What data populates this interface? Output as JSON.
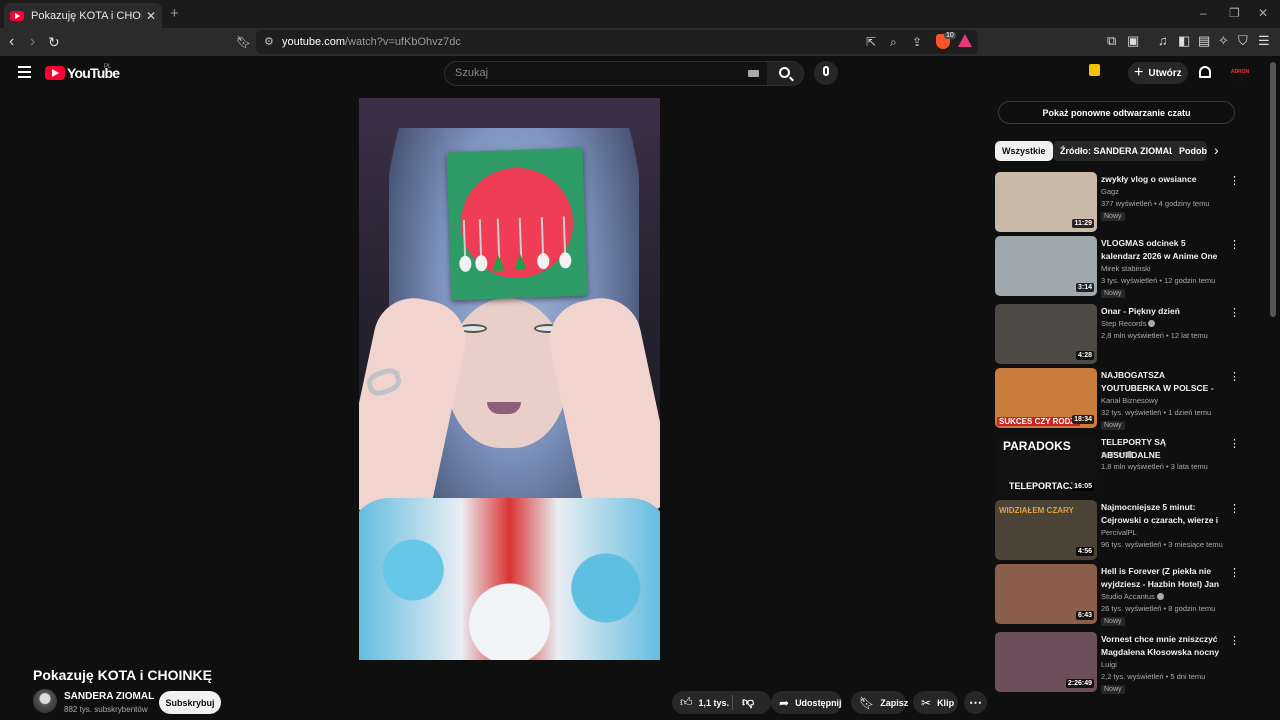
{
  "browser": {
    "tab_title": "Pokazuję KOTA i CHOINKĘ - YouTube",
    "url_host": "youtube.com",
    "url_path": "/watch?v=ufKbOhvz7dc",
    "brave_count": "10"
  },
  "header": {
    "logo_text": "YouTube",
    "country": "PL",
    "search_placeholder": "Szukaj",
    "create_label": "Utwórz",
    "avatar_text": "ADRON"
  },
  "video": {
    "title": "Pokazuję KOTA i CHOINKĘ",
    "channel": "SANDERA ZIOMAL",
    "subscribers": "882 tys. subskrybentów",
    "subscribe_label": "Subskrybuj",
    "likes": "1,1 tys.",
    "share_label": "Udostępnij",
    "save_label": "Zapisz",
    "clip_label": "Klip"
  },
  "sidebar": {
    "chat_replay": "Pokaż ponowne odtwarzanie czatu",
    "chips": [
      "Wszystkie",
      "Źródło: SANDERA ZIOMAL",
      "Podobne"
    ],
    "recommendations": [
      {
        "title": "zwykły vlog o owsiance",
        "channel": "Gagz",
        "verified": false,
        "stats": "377 wyświetleń • 4 godziny temu",
        "badge": "Nowy",
        "duration": "11:29",
        "thumb_color": "#c9b9a8"
      },
      {
        "title": "VLOGMAS odcinek 5 kalendarz 2026 w Anime One Piece ...",
        "channel": "Mirek stabinski",
        "verified": false,
        "stats": "3 tys. wyświetleń • 12 godzin temu",
        "badge": "Nowy",
        "duration": "3:14",
        "thumb_color": "#9fa8ad"
      },
      {
        "title": "Onar - Piękny dzień",
        "channel": "Step Records",
        "verified": true,
        "stats": "2,8 mln wyświetleń • 12 lat temu",
        "badge": "",
        "duration": "4:28",
        "thumb_color": "#4d4a45"
      },
      {
        "title": "NAJBOGATSZA YOUTUBERKA W POLSCE - JAK POWSTAŁA ...",
        "channel": "Kanał Biznesowy",
        "verified": false,
        "stats": "32 tys. wyświetleń • 1 dzień temu",
        "badge": "Nowy",
        "duration": "18:34",
        "thumb_color": "#c97d3a"
      },
      {
        "title": "TELEPORTY SĄ ABSURDALNE",
        "channel": "SciFun",
        "verified": true,
        "stats": "1,8 mln wyświetleń • 3 lata temu",
        "badge": "",
        "duration": "16:05",
        "thumb_color": "#111111"
      },
      {
        "title": "Najmocniejsze 5 minut: Cejrowski o czarach, wierze i ...",
        "channel": "PercivalPL",
        "verified": false,
        "stats": "96 tys. wyświetleń • 3 miesiące temu",
        "badge": "",
        "duration": "4:56",
        "thumb_color": "#4a4336"
      },
      {
        "title": "Hell is Forever (Z piekła nie wyjdziesz - Hazbin Hotel) Jan ...",
        "channel": "Studio Accantus",
        "verified": true,
        "stats": "26 tys. wyświetleń • 8 godzin temu",
        "badge": "Nowy",
        "duration": "6:43",
        "thumb_color": "#8b5e4c"
      },
      {
        "title": "Vornest chce mnie zniszczyć Magdalena Kłosowska nocny ...",
        "channel": "Luigi",
        "verified": false,
        "stats": "2,2 tys. wyświetleń • 5 dni temu",
        "badge": "Nowy",
        "duration": "2:26:49",
        "thumb_color": "#6c4f5a"
      }
    ]
  },
  "thumb_captions": {
    "rec3": "SUKCES CZY RODZI",
    "rec4_top": "PARADOKS",
    "rec4_bottom": "TELEPORTACJI",
    "rec5": "WIDZIAŁEM CZARY"
  }
}
